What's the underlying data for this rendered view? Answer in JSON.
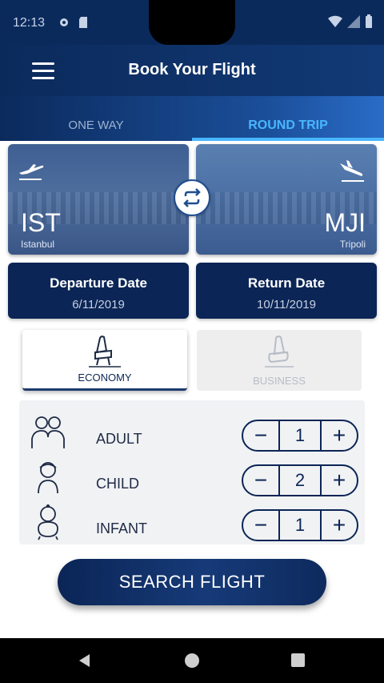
{
  "status_bar": {
    "time": "12:13"
  },
  "header": {
    "title": "Book Your Flight"
  },
  "tabs": [
    {
      "label": "ONE WAY",
      "active": false
    },
    {
      "label": "ROUND TRIP",
      "active": true
    }
  ],
  "origin": {
    "code": "IST",
    "city": "Istanbul"
  },
  "destination": {
    "code": "MJI",
    "city": "Tripoli"
  },
  "dates": {
    "departure_label": "Departure Date",
    "departure_value": "6/11/2019",
    "return_label": "Return Date",
    "return_value": "10/11/2019"
  },
  "cabin_class": {
    "economy_label": "ECONOMY",
    "business_label": "BUSINESS",
    "selected": "ECONOMY"
  },
  "passengers": [
    {
      "label": "ADULT",
      "count": "1"
    },
    {
      "label": "CHILD",
      "count": "2"
    },
    {
      "label": "INFANT",
      "count": "1"
    }
  ],
  "stepper": {
    "minus": "−",
    "plus": "+"
  },
  "search": {
    "label": "SEARCH FLIGHT"
  },
  "colors": {
    "primary": "#0b2556",
    "accent": "#49b6ff"
  }
}
